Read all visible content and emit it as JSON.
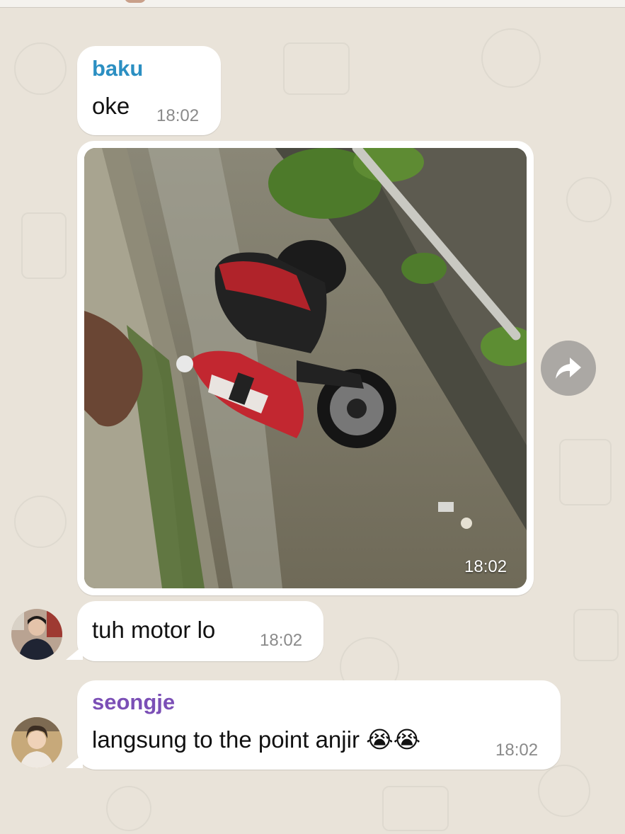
{
  "colors": {
    "baku_name": "#2b8fc2",
    "seongje_name": "#7b4fb6",
    "bubble": "#ffffff",
    "timestamp": "#8a8a8a"
  },
  "messages": [
    {
      "sender": "baku",
      "text": "oke",
      "time": "18:02"
    },
    {
      "type": "photo",
      "alt_icon": "motorcycle-in-ditch-photo",
      "time": "18:02"
    },
    {
      "text": "tuh motor lo",
      "time": "18:02"
    },
    {
      "sender": "seongje",
      "text": "langsung to the point anjir 😭😭",
      "time": "18:02"
    }
  ],
  "forward_icon": "share-arrow-icon"
}
